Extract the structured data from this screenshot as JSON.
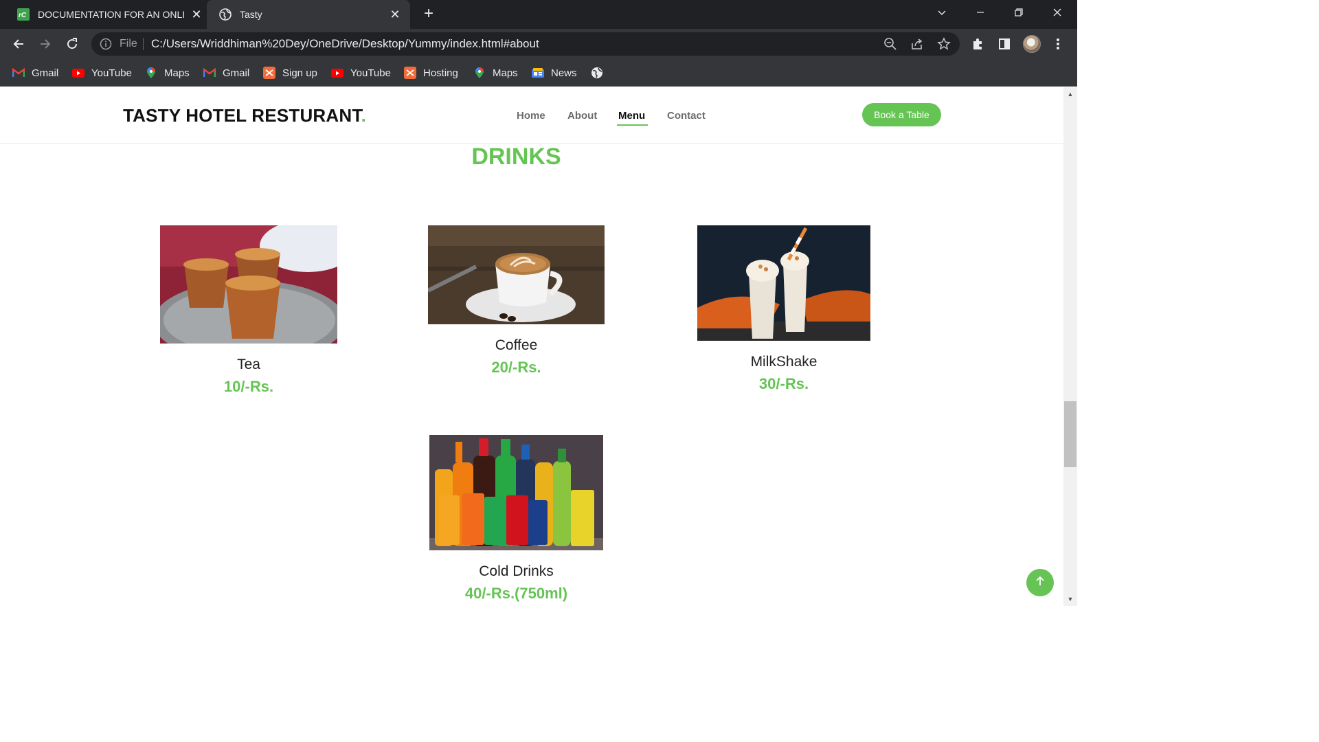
{
  "browser": {
    "tabs": [
      {
        "title": "DOCUMENTATION FOR AN ONLINE",
        "favicon": "rc-logo-icon"
      },
      {
        "title": "Tasty",
        "favicon": "globe-icon",
        "active": true
      }
    ],
    "address": {
      "scheme_label": "File",
      "url": "C:/Users/Wriddhiman%20Dey/OneDrive/Desktop/Yummy/index.html#about"
    },
    "bookmarks": [
      {
        "label": "Gmail",
        "icon": "gmail-icon"
      },
      {
        "label": "YouTube",
        "icon": "youtube-icon"
      },
      {
        "label": "Maps",
        "icon": "maps-icon"
      },
      {
        "label": "Gmail",
        "icon": "gmail-icon"
      },
      {
        "label": "Sign up",
        "icon": "codeanywhere-icon"
      },
      {
        "label": "YouTube",
        "icon": "youtube-icon"
      },
      {
        "label": "Hosting",
        "icon": "codeanywhere-icon"
      },
      {
        "label": "Maps",
        "icon": "maps-icon"
      },
      {
        "label": "News",
        "icon": "google-news-icon"
      },
      {
        "label": "",
        "icon": "globe-icon"
      }
    ]
  },
  "site": {
    "logo": "TASTY HOTEL RESTURANT",
    "logo_dot": ".",
    "nav": [
      {
        "label": "Home"
      },
      {
        "label": "About"
      },
      {
        "label": "Menu",
        "active": true
      },
      {
        "label": "Contact"
      }
    ],
    "cta": "Book a Table",
    "accent_color": "#65c454"
  },
  "menu": {
    "section_title": "DRINKS",
    "items": [
      {
        "name": "Tea",
        "price": "10/-Rs.",
        "image": "tea-image"
      },
      {
        "name": "Coffee",
        "price": "20/-Rs.",
        "image": "coffee-image"
      },
      {
        "name": "MilkShake",
        "price": "30/-Rs.",
        "image": "milkshake-image"
      },
      {
        "name": "Cold Drinks",
        "price": "40/-Rs.(750ml)",
        "image": "cold-drinks-image"
      }
    ]
  }
}
